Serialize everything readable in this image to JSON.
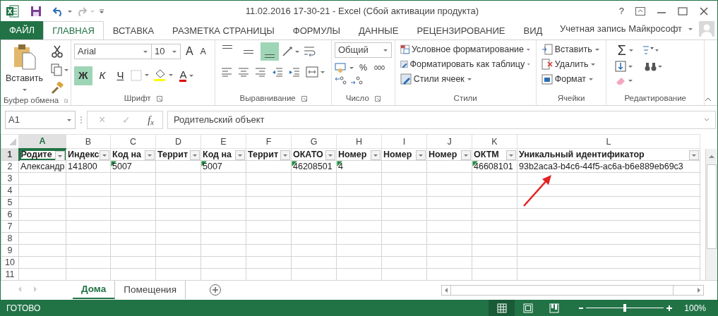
{
  "title": "11.02.2016 17-30-21 - Excel (Сбой активации продукта)",
  "help_button": "?",
  "file_tab": "ФАЙЛ",
  "tabs": [
    {
      "label": "ГЛАВНАЯ",
      "selected": true
    },
    {
      "label": "ВСТАВКА",
      "selected": false
    },
    {
      "label": "РАЗМЕТКА СТРАНИЦЫ",
      "selected": false
    },
    {
      "label": "ФОРМУЛЫ",
      "selected": false
    },
    {
      "label": "ДАННЫЕ",
      "selected": false
    },
    {
      "label": "РЕЦЕНЗИРОВАНИЕ",
      "selected": false
    },
    {
      "label": "ВИД",
      "selected": false
    }
  ],
  "account": "Учетная запись Майкрософт",
  "ribbon": {
    "clipboard": {
      "paste": "Вставить",
      "label": "Буфер обмена"
    },
    "font": {
      "family": "Arial",
      "size": "10",
      "grow": "A",
      "shrink": "A",
      "styles": [
        {
          "label": "Ж",
          "on": true
        },
        {
          "label": "К",
          "on": false
        },
        {
          "label": "Ч",
          "on": false
        }
      ],
      "color_letter": "А",
      "label": "Шрифт"
    },
    "alignment": {
      "vertical": [
        {
          "on": false
        },
        {
          "on": false
        },
        {
          "on": true
        }
      ],
      "label": "Выравнивание"
    },
    "number": {
      "format": "Общий",
      "percent": "%",
      "thousands": "000",
      "label": "Число"
    },
    "styles": {
      "items": [
        "Условное форматирование",
        "Форматировать как таблицу",
        "Стили ячеек"
      ],
      "label": "Стили"
    },
    "cells": {
      "items": [
        "Вставить",
        "Удалить",
        "Формат"
      ],
      "label": "Ячейки"
    },
    "editing": {
      "sum": "Σ",
      "label": "Редактирование"
    }
  },
  "formula_bar": {
    "name_box": "A1",
    "cancel": "×",
    "enter": "✓",
    "fx": "f$_{x}$",
    "value": "Родительский объект"
  },
  "grid": {
    "columns": [
      {
        "label": "A",
        "selected": true
      },
      {
        "label": "B",
        "selected": false
      },
      {
        "label": "C",
        "selected": false
      },
      {
        "label": "D",
        "selected": false
      },
      {
        "label": "E",
        "selected": false
      },
      {
        "label": "F",
        "selected": false
      },
      {
        "label": "G",
        "selected": false
      },
      {
        "label": "H",
        "selected": false
      },
      {
        "label": "I",
        "selected": false
      },
      {
        "label": "J",
        "selected": false
      },
      {
        "label": "K",
        "selected": false
      },
      {
        "label": "L",
        "selected": false
      }
    ],
    "rows": [
      {
        "number": "1",
        "selected": true,
        "kind": "header",
        "cells": [
          {
            "text": "Родите"
          },
          {
            "text": "Индекс"
          },
          {
            "text": "Код на"
          },
          {
            "text": "Террит"
          },
          {
            "text": "Код на"
          },
          {
            "text": "Террит"
          },
          {
            "text": "ОКАТО"
          },
          {
            "text": "Номер"
          },
          {
            "text": "Номер"
          },
          {
            "text": "Номер"
          },
          {
            "text": "ОКТМ"
          },
          {
            "text": "Уникальный идентификатор"
          }
        ]
      },
      {
        "number": "2",
        "selected": false,
        "kind": "data",
        "cells": [
          {
            "text": "Александр",
            "marked": false
          },
          {
            "text": "141800",
            "marked": false
          },
          {
            "text": "5007",
            "marked": true
          },
          {
            "marked": false
          },
          {
            "text": "5007",
            "marked": true
          },
          {
            "marked": false
          },
          {
            "text": "46208501",
            "marked": true
          },
          {
            "text": "4",
            "marked": true
          },
          {
            "marked": false
          },
          {
            "marked": false
          },
          {
            "text": "46608101",
            "marked": true
          },
          {
            "text": "93b2aca3-b4c6-44f5-ac6a-b6e889eb69c3",
            "marked": false
          }
        ]
      }
    ],
    "empty_rows": [
      "3",
      "4",
      "5",
      "6",
      "7",
      "8",
      "9",
      "10",
      "11"
    ]
  },
  "sheets": [
    {
      "label": "Дома",
      "selected": true
    },
    {
      "label": "Помещения",
      "selected": false
    }
  ],
  "status": {
    "text": "ГОТОВО",
    "views": [
      {
        "selected": true
      },
      {
        "selected": false
      },
      {
        "selected": false
      }
    ],
    "zoom": {
      "level": 0.5
    },
    "zoom_text": "100%"
  }
}
